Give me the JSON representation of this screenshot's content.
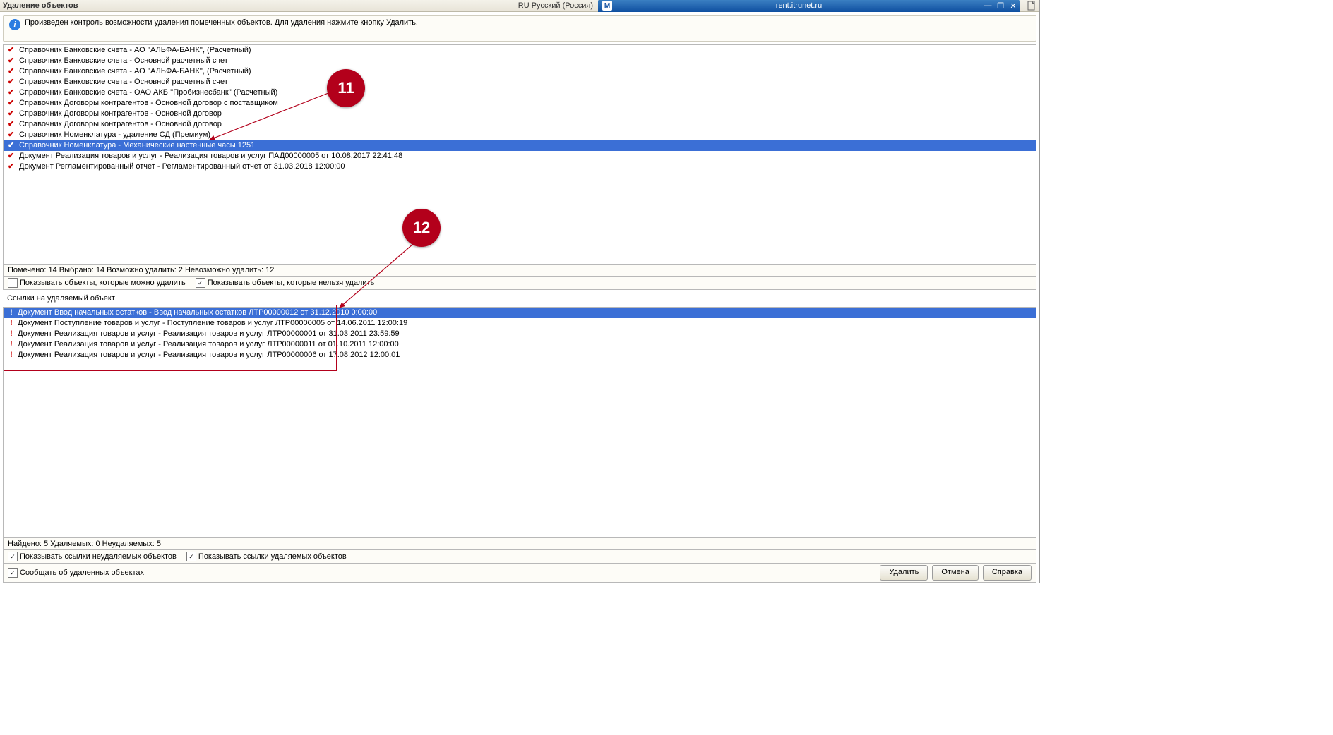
{
  "titlebar": {
    "title": "Удаление объектов"
  },
  "language_indicator": "RU Русский (Россия)",
  "bluetab": {
    "icon_letter": "М",
    "label": "rent.itrunet.ru"
  },
  "info": {
    "text": "Произведен контроль возможности удаления помеченных объектов. Для удаления нажмите кнопку Удалить."
  },
  "top_list": [
    {
      "text": "Справочник Банковские счета - АО ''АЛЬФА-БАНК'', (Расчетный)"
    },
    {
      "text": "Справочник Банковские счета - Основной расчетный счет"
    },
    {
      "text": "Справочник Банковские счета - АО ''АЛЬФА-БАНК'', (Расчетный)"
    },
    {
      "text": "Справочник Банковские счета - Основной расчетный счет"
    },
    {
      "text": "Справочник Банковские счета - ОАО АКБ ''Пробизнесбанк'' (Расчетный)"
    },
    {
      "text": "Справочник Договоры контрагентов - Основной договор с поставщиком"
    },
    {
      "text": "Справочник Договоры контрагентов - Основной договор"
    },
    {
      "text": "Справочник Договоры контрагентов - Основной договор"
    },
    {
      "text": "Справочник Номенклатура - удаление СД (Премиум)"
    },
    {
      "text": "Справочник Номенклатура - Механические настенные часы 1251",
      "selected": true
    },
    {
      "text": "Документ Реализация товаров и услуг - Реализация товаров и услуг ПАД00000005 от 10.08.2017 22:41:48"
    },
    {
      "text": "Документ Регламентированный отчет - Регламентированный отчет от 31.03.2018 12:00:00"
    }
  ],
  "stat1": "Помечено: 14  Выбрано: 14  Возможно удалить: 2  Невозможно удалить: 12",
  "cb1": {
    "a": {
      "checked": false,
      "label": "Показывать объекты, которые можно удалить"
    },
    "b": {
      "checked": true,
      "label": "Показывать объекты, которые нельзя удалить"
    }
  },
  "section2_title": "Ссылки на удаляемый объект",
  "bottom_list": [
    {
      "text": "Документ Ввод начальных остатков - Ввод начальных остатков ЛТР00000012 от 31.12.2010 0:00:00",
      "selected": true
    },
    {
      "text": "Документ Поступление товаров и услуг - Поступление товаров и услуг ЛТР00000005 от 14.06.2011 12:00:19"
    },
    {
      "text": "Документ Реализация товаров и услуг - Реализация товаров и услуг ЛТР00000001 от 31.03.2011 23:59:59"
    },
    {
      "text": "Документ Реализация товаров и услуг - Реализация товаров и услуг ЛТР00000011 от 01.10.2011 12:00:00"
    },
    {
      "text": "Документ Реализация товаров и услуг - Реализация товаров и услуг ЛТР00000006 от 17.08.2012 12:00:01"
    }
  ],
  "stat2": "Найдено: 5  Удаляемых: 0  Неудаляемых: 5",
  "cb2": {
    "a": {
      "checked": true,
      "label": "Показывать ссылки неудаляемых объектов"
    },
    "b": {
      "checked": true,
      "label": "Показывать ссылки удаляемых объектов"
    }
  },
  "cb3": {
    "checked": true,
    "label": "Сообщать об удаленных объектах"
  },
  "buttons": {
    "delete": "Удалить",
    "cancel": "Отмена",
    "help": "Справка"
  },
  "badges": {
    "b11": "11",
    "b12": "12"
  }
}
